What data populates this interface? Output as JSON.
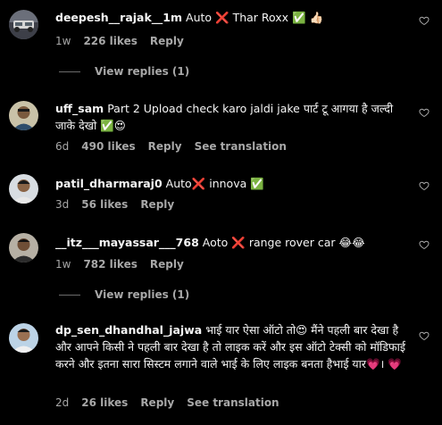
{
  "comments": [
    {
      "username": "deepesh__rajak__1m",
      "text": "Auto ❌ Thar Roxx ✅ 👍🏻",
      "time": "1w",
      "likes": "226 likes",
      "reply": "Reply",
      "view_replies": "View replies (1)"
    },
    {
      "username": "uff_sam",
      "text": "Part 2 Upload check karo jaldi jake पार्ट टू आगया है जल्दी जाके देखो ✅😍",
      "time": "6d",
      "likes": "490 likes",
      "reply": "Reply",
      "see_translation": "See translation"
    },
    {
      "username": "patil_dharmaraj0",
      "text": "Auto❌ innova ✅",
      "time": "3d",
      "likes": "56 likes",
      "reply": "Reply"
    },
    {
      "username": "__itz___mayassar___768",
      "text": "Aoto ❌ range rover car 😂😂",
      "time": "1w",
      "likes": "782 likes",
      "reply": "Reply",
      "view_replies": "View replies (1)"
    },
    {
      "username": "dp_sen_dhandhal_jajwa",
      "text": "भाई यार ऐसा ऑटो तो😍 मैंने पहली बार देखा है और आपने किसी ने पहली बार देखा है तो लाइक करें और इस ऑटो टेक्सी को मॉडिफाई करने और इतना सारा सिस्टम लगाने वाले भाई के लिए लाइक बनता हैभाई यार💗। 💗",
      "time": "2d",
      "likes": "26 likes",
      "reply": "Reply",
      "see_translation": "See translation"
    }
  ],
  "icons": {
    "like": "heart-outline-icon",
    "avatar": "user-avatar"
  },
  "colors": {
    "background": "#000000",
    "text": "#f5f5f5",
    "secondary": "#a8a8a8"
  }
}
